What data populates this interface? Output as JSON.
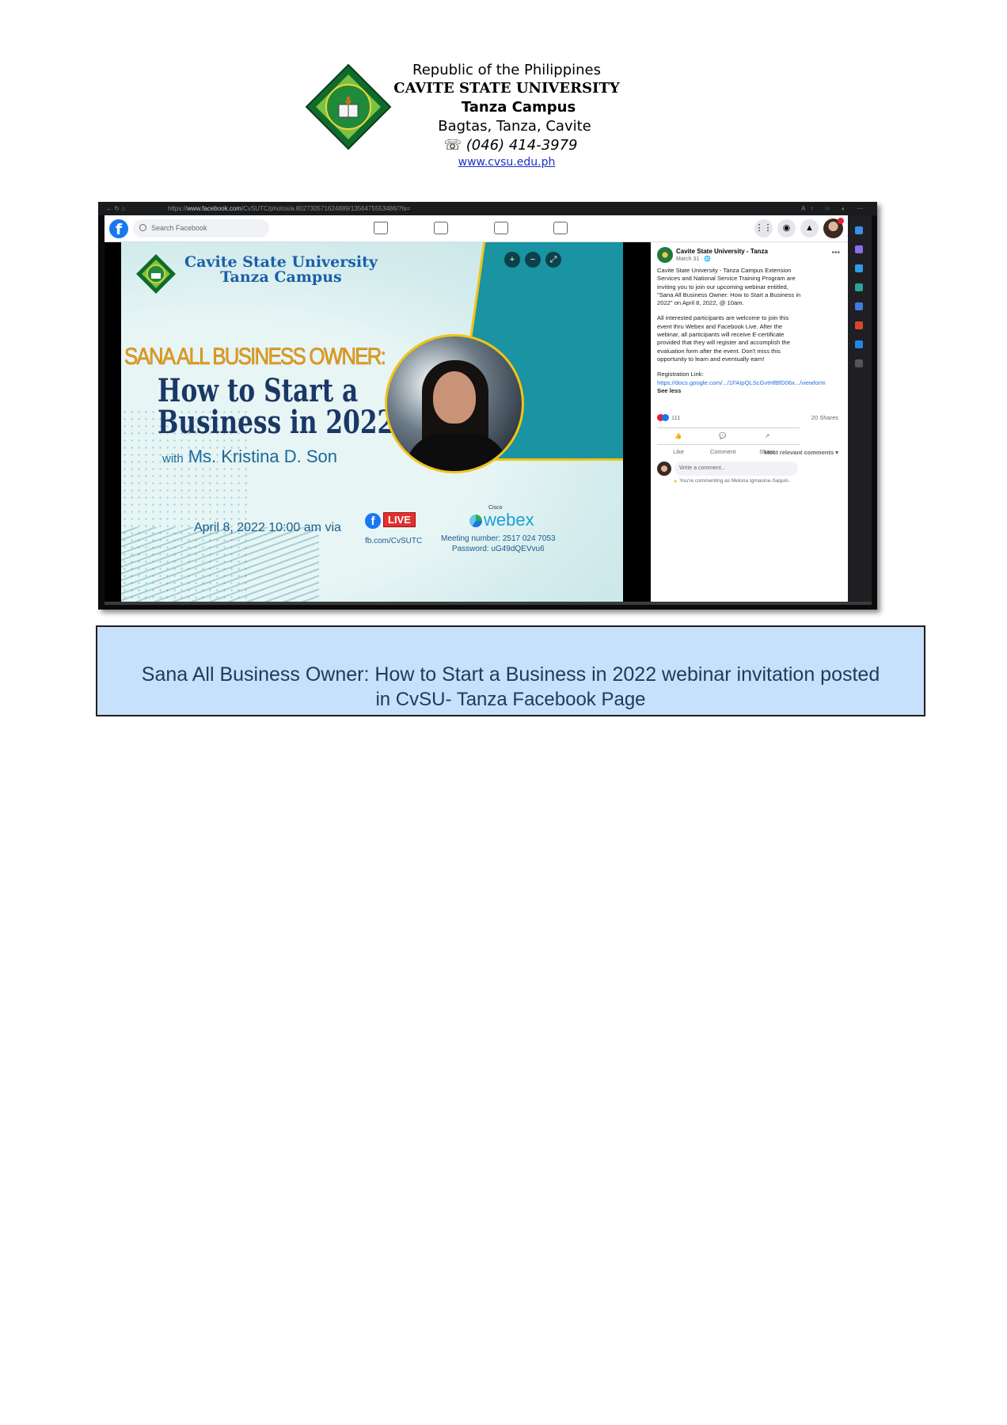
{
  "letterhead": {
    "line1": "Republic of the Philippines",
    "line2": "CAVITE STATE UNIVERSITY",
    "line3": "Tanza Campus",
    "line4": "Bagtas, Tanza, Cavite",
    "phone": "☏ (046) 414-3979",
    "website": "www.cvsu.edu.ph"
  },
  "browser": {
    "url_prefix": "https://",
    "url_domain": "www.facebook.com",
    "url_path": "/CvSUTC/photos/a.802730571624889/1356475553486/?ts=",
    "nav": "← ↻ ⌂"
  },
  "facebook": {
    "search_placeholder": "Search Facebook",
    "logo_glyph": "f"
  },
  "poster": {
    "university": "Cavite State University",
    "campus": "Tanza Campus",
    "headline": "SANA ALL BUSINESS OWNER:",
    "title_line1": "How to Start a",
    "title_line2": "Business in 2022",
    "with": "with",
    "speaker": "Ms. Kristina D. Son",
    "date": "April 8, 2022  10:00 am  via",
    "live": "LIVE",
    "fb_url": "fb.com/CvSUTC",
    "cisco": "Cisco",
    "webex": "webex",
    "meeting": "Meeting number: 2517 024 7053",
    "password": "Password: uG49dQEVvu6"
  },
  "post": {
    "page_name": "Cavite State University - Tanza",
    "date": "March 31 · 🌐",
    "paragraph1": "Cavite State University - Tanza Campus Extension Services and National Service Training Program are inviting you to join our upcoming webinar entitled, \"Sana All Business Owner: How to Start a Business in 2022\" on April 8, 2022, @ 10am.",
    "paragraph2": "All interested participants are welcome to join this event thru Webex and Facebook Live. After the webinar, all participants will receive E-certificate provided that they will register and accomplish the evaluation form after the event. Don't miss this opportunity to learn and eventually earn!",
    "registration_label": "Registration Link:",
    "registration_link": "https://docs.google.com/.../1FAIpQLScGvtHfBfD06x.../viewform",
    "see_less": "See less",
    "reactions": "111",
    "shares": "20 Shares",
    "like": "Like",
    "comment": "Comment",
    "share": "Share",
    "relevant": "Most relevant comments ▾",
    "comment_placeholder": "Write a comment...",
    "commenting_as": "You're commenting as Melona Igmasine-Saquin."
  },
  "caption": {
    "line1": "Sana All Business Owner: How to Start a Business in 2022 webinar invitation posted",
    "line2": "in CvSU- Tanza Facebook Page"
  }
}
